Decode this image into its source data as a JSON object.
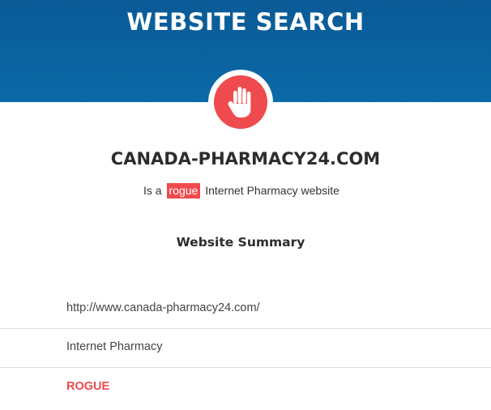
{
  "header": {
    "title": "WEBSITE SEARCH"
  },
  "badge": {
    "icon": "hand-stop-icon",
    "color": "#ef4a4d"
  },
  "result": {
    "site_name": "CANADA-PHARMACY24.COM",
    "verdict_prefix": "Is a",
    "verdict_tag": "rogue",
    "verdict_suffix": "Internet Pharmacy website"
  },
  "summary": {
    "title": "Website Summary",
    "url": "http://www.canada-pharmacy24.com/",
    "type": "Internet Pharmacy",
    "status": "ROGUE"
  },
  "colors": {
    "header_blue": "#0b6aa7",
    "rogue_red": "#ef4a4d"
  }
}
